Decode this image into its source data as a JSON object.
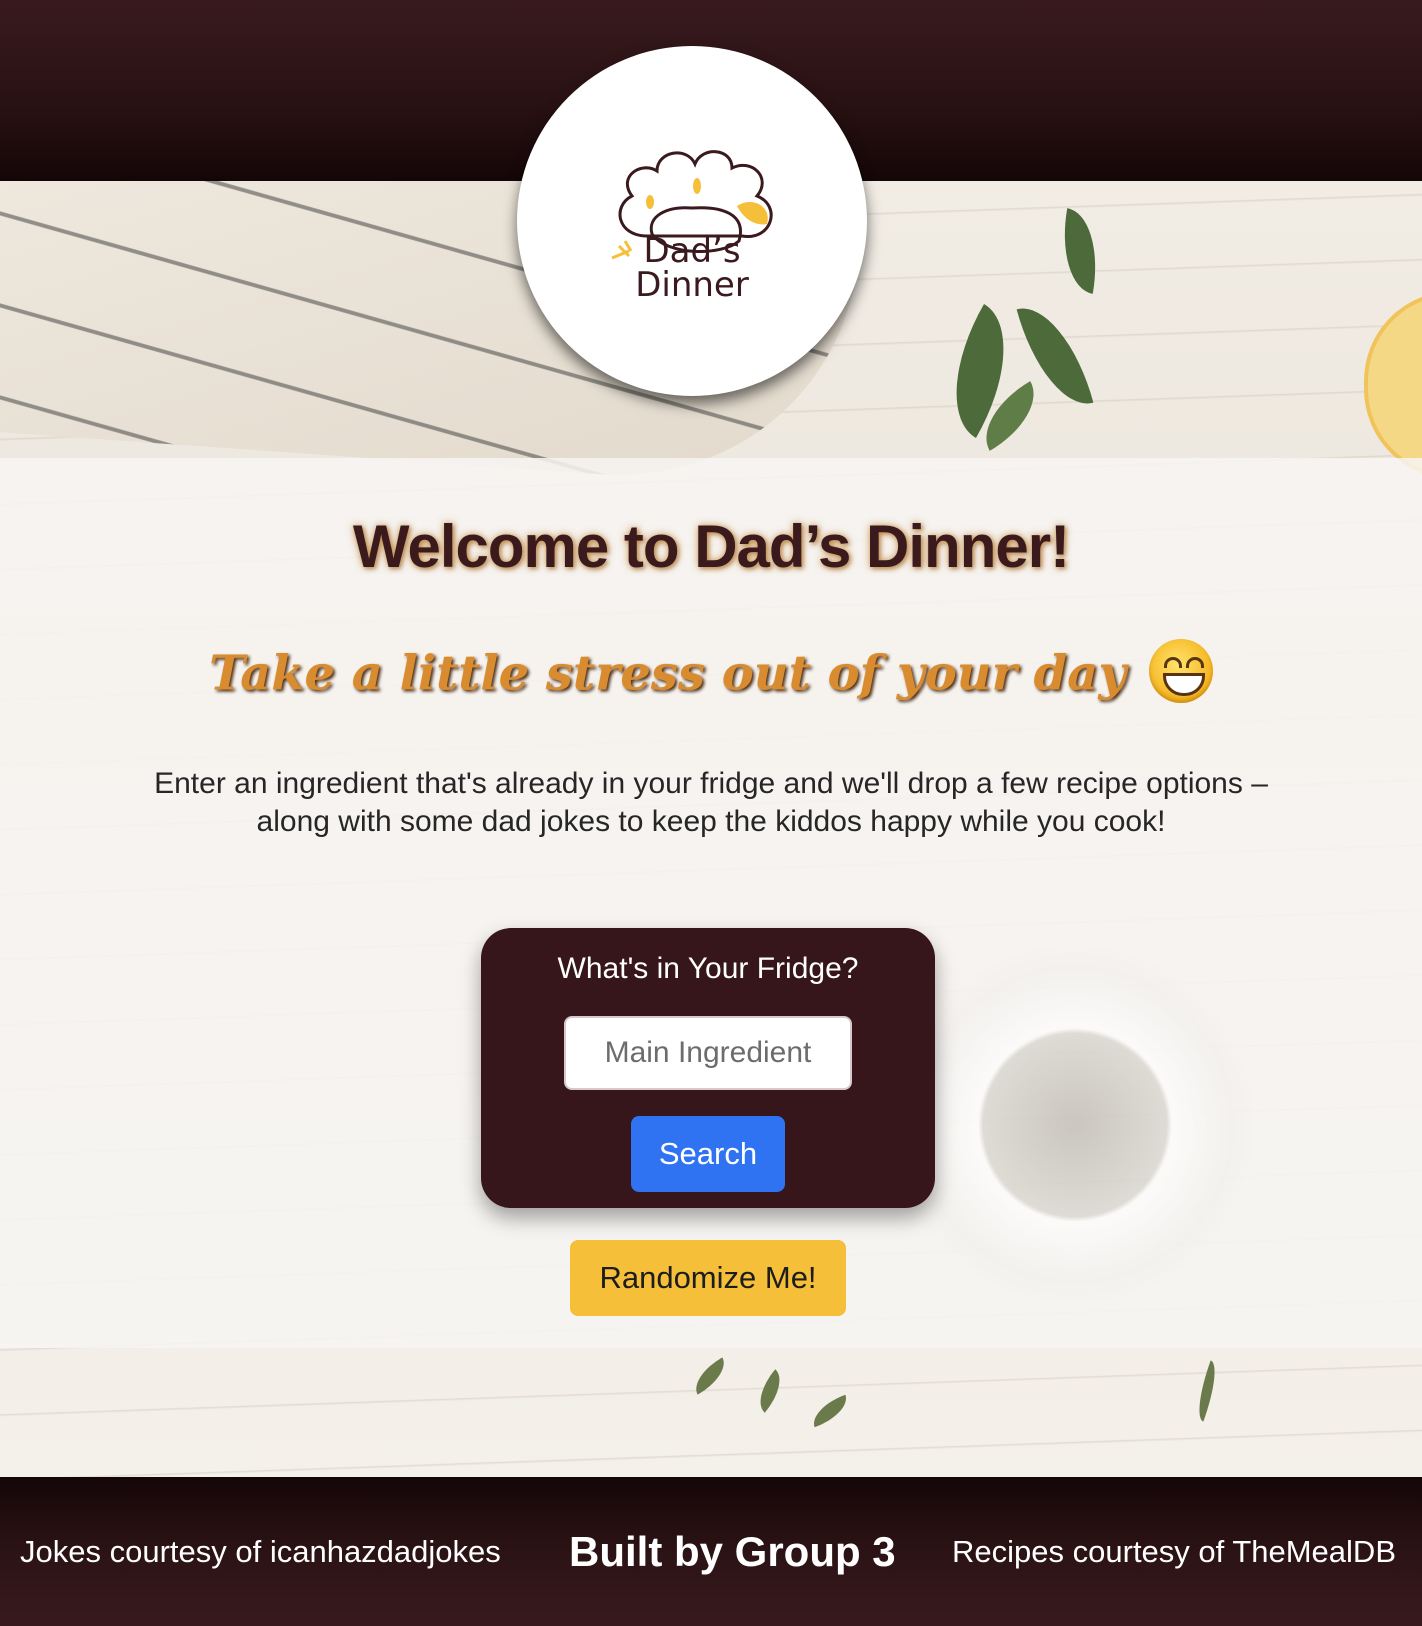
{
  "logo": {
    "line1": "Dad’s",
    "line2": "Dinner",
    "icon": "chef-hat-icon",
    "colors": {
      "outline": "#3a1a1e",
      "accent": "#f5bf3a"
    }
  },
  "hero": {
    "title": "Welcome to Dad’s Dinner!",
    "tagline": "Take a little stress out of your day",
    "tagline_icon": "grinning-face-emoji",
    "intro": "Enter an ingredient that's already in your fridge and we'll drop a few recipe options – along with some dad jokes to keep the kiddos happy while you cook!"
  },
  "search": {
    "title": "What's in Your Fridge?",
    "input_value": "",
    "input_placeholder": "Main Ingredient",
    "button_label": "Search"
  },
  "randomize": {
    "label": "Randomize Me!"
  },
  "footer": {
    "left": "Jokes courtesy of icanhazdadjokes",
    "center": "Built by Group 3",
    "right": "Recipes courtesy of TheMealDB"
  },
  "colors": {
    "header_bg": "#36161a",
    "search_button": "#2f73f2",
    "randomize_button": "#f5bf3a",
    "title_text": "#3b1a1d",
    "tagline_text": "#d98c2f"
  }
}
